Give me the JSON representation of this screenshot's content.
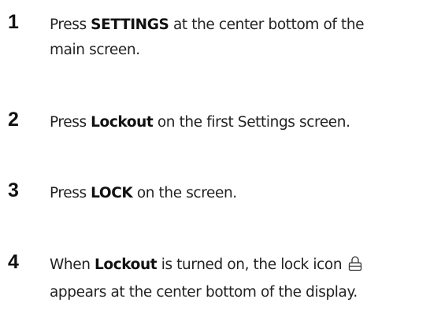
{
  "steps": [
    {
      "number": "1",
      "text_before": "Press ",
      "bold": "SETTINGS",
      "text_after": " at the center bottom of the",
      "line2": "main screen."
    },
    {
      "number": "2",
      "text_before": "Press ",
      "bold": "Lockout",
      "text_after": " on the first Settings screen."
    },
    {
      "number": "3",
      "text_before": "Press ",
      "bold": "LOCK",
      "text_after": " on the screen."
    },
    {
      "number": "4",
      "text_before": "When ",
      "bold": "Lockout",
      "text_after": " is turned on, the lock icon",
      "icon": "lock-icon",
      "line2": "appears at the center bottom of the display."
    }
  ]
}
